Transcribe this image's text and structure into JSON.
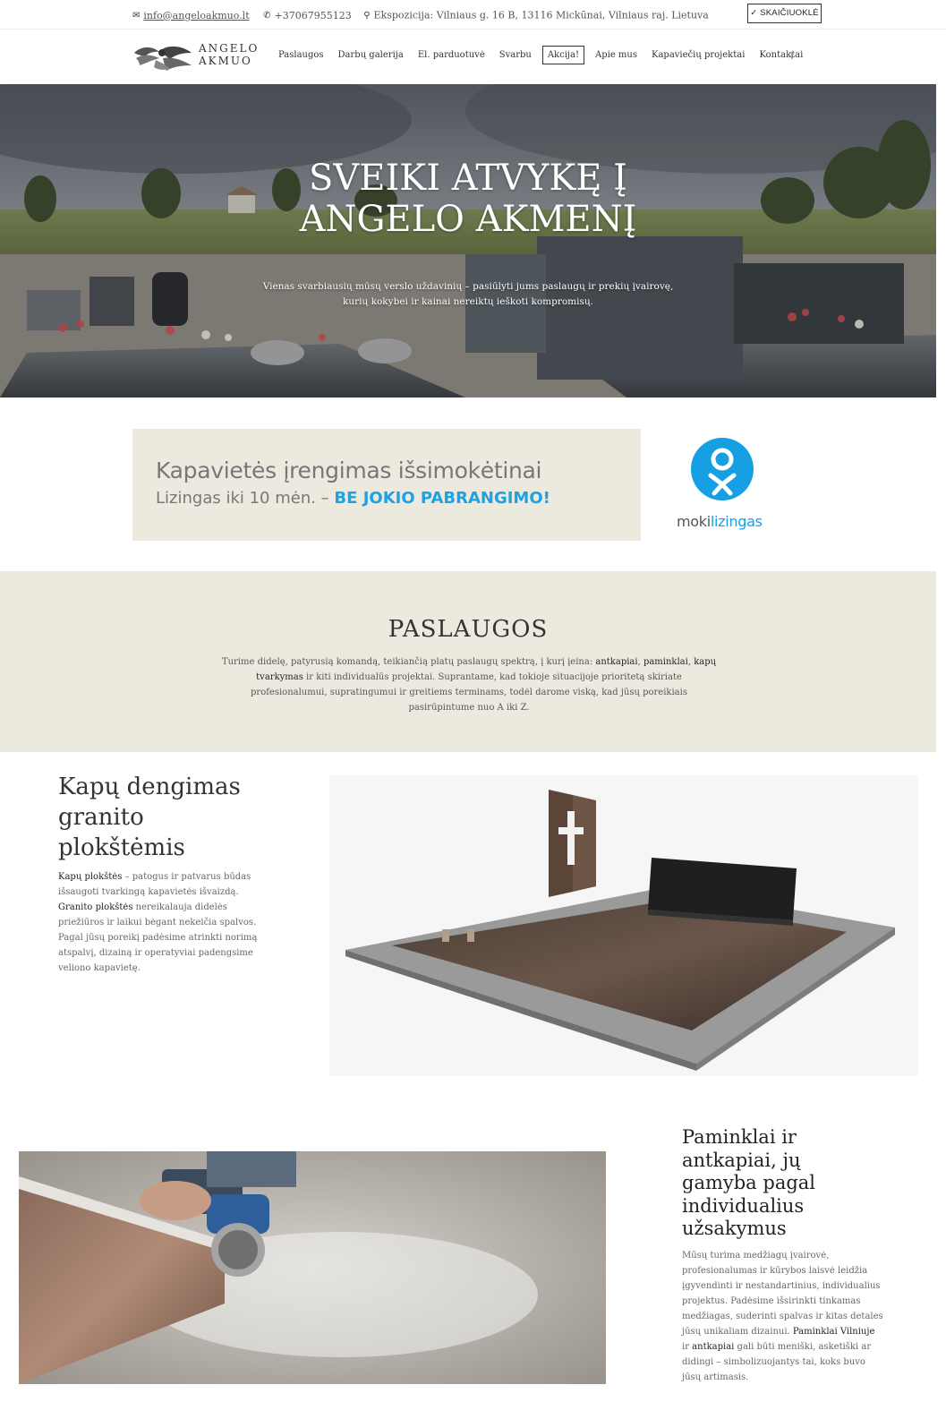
{
  "topbar": {
    "email": "info@angeloakmuo.lt",
    "phone": "+37067955123",
    "address": "Ekspozicija: Vilniaus g. 16 B, 13116 Mickūnai, Vilniaus raj. Lietuva",
    "calculator_label": "✓ SKAIČIUOKLĖ"
  },
  "logo": {
    "line1": "ANGELO",
    "line2": "AKMUO"
  },
  "nav": {
    "items": [
      "Paslaugos",
      "Darbų galerija",
      "El. parduotuvė",
      "Svarbu",
      "Akcija!",
      "Apie mus",
      "Kapaviečių projektai",
      "Kontaktai"
    ],
    "facebook_icon": "facebook-icon"
  },
  "hero": {
    "title_line1": "SVEIKI ATVYKĘ Į",
    "title_line2": "ANGELO AKMENĮ",
    "subtitle_line1": "Vienas svarbiausių mūsų verslo uždavinių – pasiūlyti jums paslaugų ir prekių įvairovę,",
    "subtitle_line2": "kurių kokybei ir kainai nereiktų ieškoti kompromisų."
  },
  "lease": {
    "line1": "Kapavietės įrengimas išsimokėtinai",
    "line2_prefix": "Lizingas iki 10 mėn. – ",
    "line2_highlight": "BE JOKIO PABRANGIMO!",
    "brand_prefix": "moki",
    "brand_suffix": "lizingas",
    "brand_color": "#16a0e3"
  },
  "services": {
    "title": "PASLAUGOS",
    "text_1": "Turime didelę, patyrusią komandą, teikiančią platų paslaugų spektrą, į kurį įeina: ",
    "highlight_1": "antkapiai",
    "sep_1": ", ",
    "highlight_2": "paminklai",
    "sep_2": ", ",
    "highlight_3": "kapų tvarkymas",
    "text_2": " ir kiti individualūs projektai. Suprantame, kad tokioje situacijoje prioritetą skiriate profesionalumui, supratingumui ir greitiems terminams, todėl darome viską, kad jūsų poreikiais pasirūpintume nuo A iki Z."
  },
  "section1": {
    "title": "Kapų dengimas granito plokštėmis",
    "highlight_1": "Kapų plokštės",
    "text_1": " – patogus ir patvarus būdas išsaugoti tvarkingą kapavietės išvaizdą. ",
    "highlight_2": "Granito plokštės",
    "text_2": " nereikalauja didelės priežiūros ir laikui bėgant nekeičia spalvos. Pagal jūsų poreikį padėsime atrinkti norimą atspalvį, dizainą ir operatyviai padengsime veliono kapavietę."
  },
  "section2": {
    "title": "Paminklai ir antkapiai, jų gamyba pagal individualius užsakymus",
    "text_1": "Mūsų turima medžiagų įvairovė, profesionalumas ir kūrybos laisvė leidžia įgyvendinti ir nestandartinius, individualius projektus. Padėsime išsirinkti tinkamas medžiagas, suderinti spalvas ir kitas detales jūsų unikaliam dizainui. ",
    "highlight_1": "Paminklai Vilniuje",
    "text_2": " ir ",
    "highlight_2": "antkapiai",
    "text_3": " gali būti meniški, asketiški ar didingi – simbolizuojantys tai, koks buvo jūsų artimasis."
  }
}
